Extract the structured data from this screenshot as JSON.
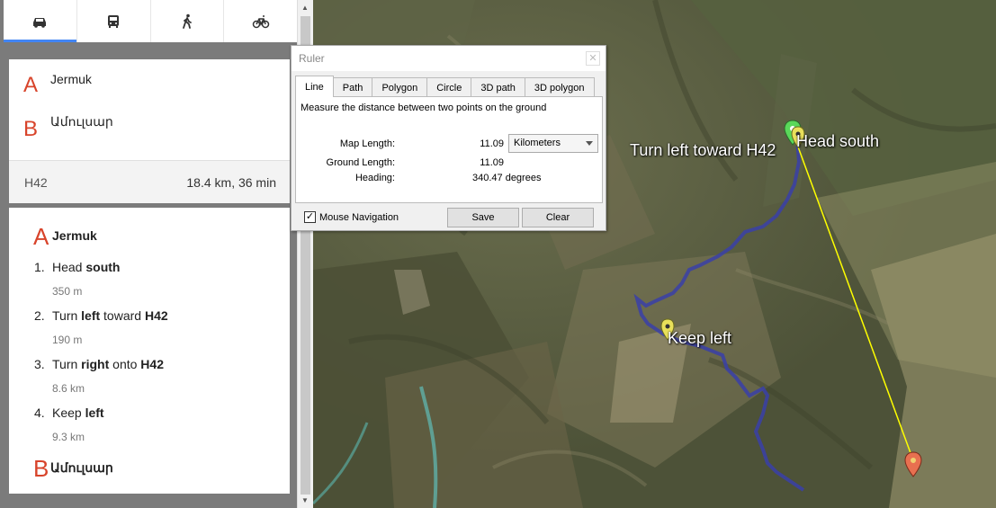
{
  "modes": [
    {
      "name": "driving",
      "icon": "car-icon",
      "active": true
    },
    {
      "name": "transit",
      "icon": "bus-icon",
      "active": false
    },
    {
      "name": "walking",
      "icon": "walk-icon",
      "active": false
    },
    {
      "name": "cycling",
      "icon": "bike-icon",
      "active": false
    }
  ],
  "route": {
    "origin_letter": "A",
    "origin": "Jermuk",
    "destination_letter": "B",
    "destination": "Ամուլսար",
    "via": "H42",
    "distance_time": "18.4 km,  36 min"
  },
  "directions": {
    "start_letter": "A",
    "start": "Jermuk",
    "steps": [
      {
        "num": "1.",
        "pre": "Head ",
        "b1": "south",
        "mid": "",
        "b2": "",
        "dist": "350 m"
      },
      {
        "num": "2.",
        "pre": "Turn ",
        "b1": "left",
        "mid": " toward ",
        "b2": "H42",
        "dist": "190 m"
      },
      {
        "num": "3.",
        "pre": "Turn ",
        "b1": "right",
        "mid": " onto ",
        "b2": "H42",
        "dist": "8.6 km"
      },
      {
        "num": "4.",
        "pre": "Keep ",
        "b1": "left",
        "mid": "",
        "b2": "",
        "dist": "9.3 km"
      }
    ],
    "end_letter": "B",
    "end": "Ամուլսար"
  },
  "ruler": {
    "title": "Ruler",
    "tabs": [
      "Line",
      "Path",
      "Polygon",
      "Circle",
      "3D path",
      "3D polygon"
    ],
    "active_tab": "Line",
    "description": "Measure the distance between two points on the ground",
    "map_length_label": "Map Length:",
    "map_length_value": "11.09",
    "unit": "Kilometers",
    "ground_length_label": "Ground Length:",
    "ground_length_value": "11.09",
    "heading_label": "Heading:",
    "heading_value": "340.47 degrees",
    "mouse_nav_label": "Mouse Navigation",
    "mouse_nav_checked": true,
    "save_label": "Save",
    "clear_label": "Clear"
  },
  "map": {
    "labels": {
      "turn_left": "Turn left toward H42",
      "head_south": "Head south",
      "keep_left": "Keep left"
    },
    "colors": {
      "route": "#3a3fa8",
      "ruler_line": "#ffff00",
      "start_pin": "#5ad85a",
      "step_pin": "#e8e05a",
      "end_pin": "#e87050"
    }
  }
}
